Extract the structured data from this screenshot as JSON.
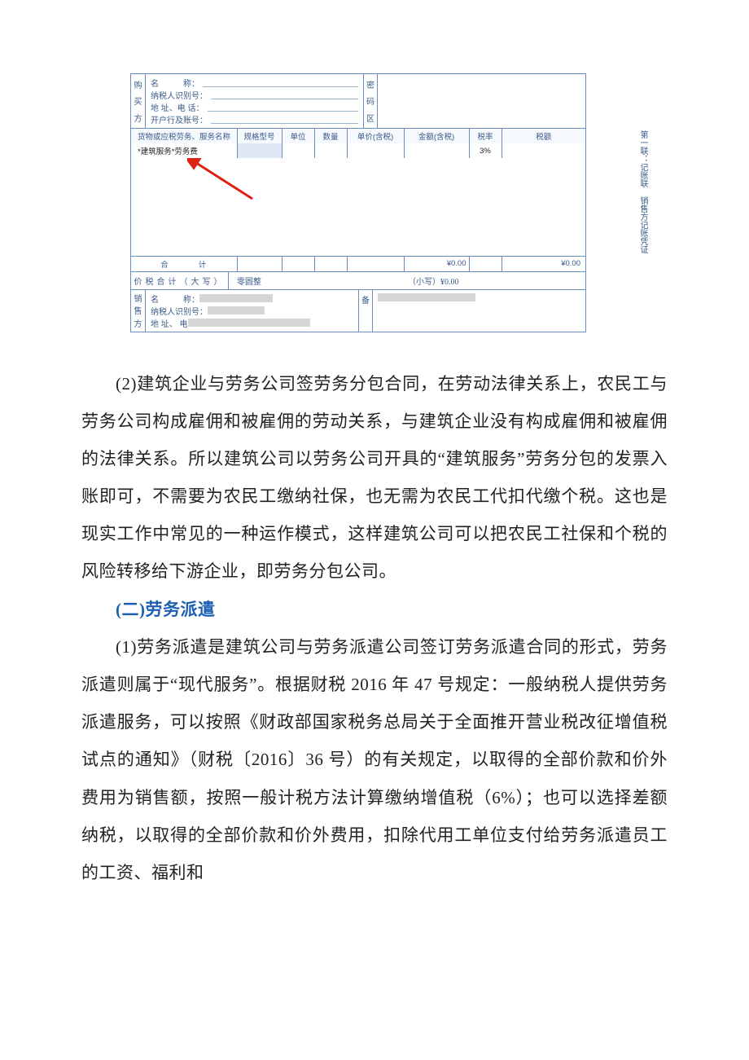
{
  "invoice": {
    "buyer_label": [
      "购",
      "买",
      "方"
    ],
    "buyer_fields": {
      "name": "名　　　称：",
      "tax_id": "纳税人识别号：",
      "addr": "地 址、电 话：",
      "bank": "开户行及账号："
    },
    "password_label": [
      "密",
      "码",
      "区"
    ],
    "headers": {
      "name": "货物或应税劳务、服务名称",
      "spec": "规格型号",
      "unit": "单位",
      "qty": "数量",
      "unit_price": "单价(含税)",
      "amount": "金额(含税)",
      "rate": "税率",
      "tax": "税额"
    },
    "item": {
      "name": "*建筑服务*劳务费",
      "rate": "3%"
    },
    "totals": {
      "label": "合　　计",
      "amount": "¥0.00",
      "tax": "¥0.00"
    },
    "grand": {
      "label": "价税合计（大写）",
      "chinese": "零圆整",
      "num_label": "（小写）",
      "num": "¥0.00"
    },
    "seller_label": [
      "销",
      "售",
      "方"
    ],
    "seller_fields": {
      "name": "名　　　称：",
      "tax_id": "纳税人识别号：",
      "addr": "地 址、 电"
    },
    "remark_label": "备",
    "side_note": "第一联：记账联 销售方记账凭证"
  },
  "text": {
    "p1": "(2)建筑企业与劳务公司签劳务分包合同，在劳动法律关系上，农民工与劳务公司构成雇佣和被雇佣的劳动关系，与建筑企业没有构成雇佣和被雇佣的法律关系。所以建筑公司以劳务公司开具的“建筑服务”劳务分包的发票入账即可，不需要为农民工缴纳社保，也无需为农民工代扣代缴个税。这也是现实工作中常见的一种运作模式，这样建筑公司可以把农民工社保和个税的风险转移给下游企业，即劳务分包公司。",
    "h2": "(二)劳务派遣",
    "p2": "(1)劳务派遣是建筑公司与劳务派遣公司签订劳务派遣合同的形式，劳务派遣则属于“现代服务”。根据财税 2016 年 47 号规定：一般纳税人提供劳务派遣服务，可以按照《财政部国家税务总局关于全面推开营业税改征增值税试点的通知》（财税〔2016〕36 号）的有关规定，以取得的全部价款和价外费用为销售额，按照一般计税方法计算缴纳增值税（6%）；也可以选择差额纳税，以取得的全部价款和价外费用，扣除代用工单位支付给劳务派遣员工的工资、福利和"
  }
}
